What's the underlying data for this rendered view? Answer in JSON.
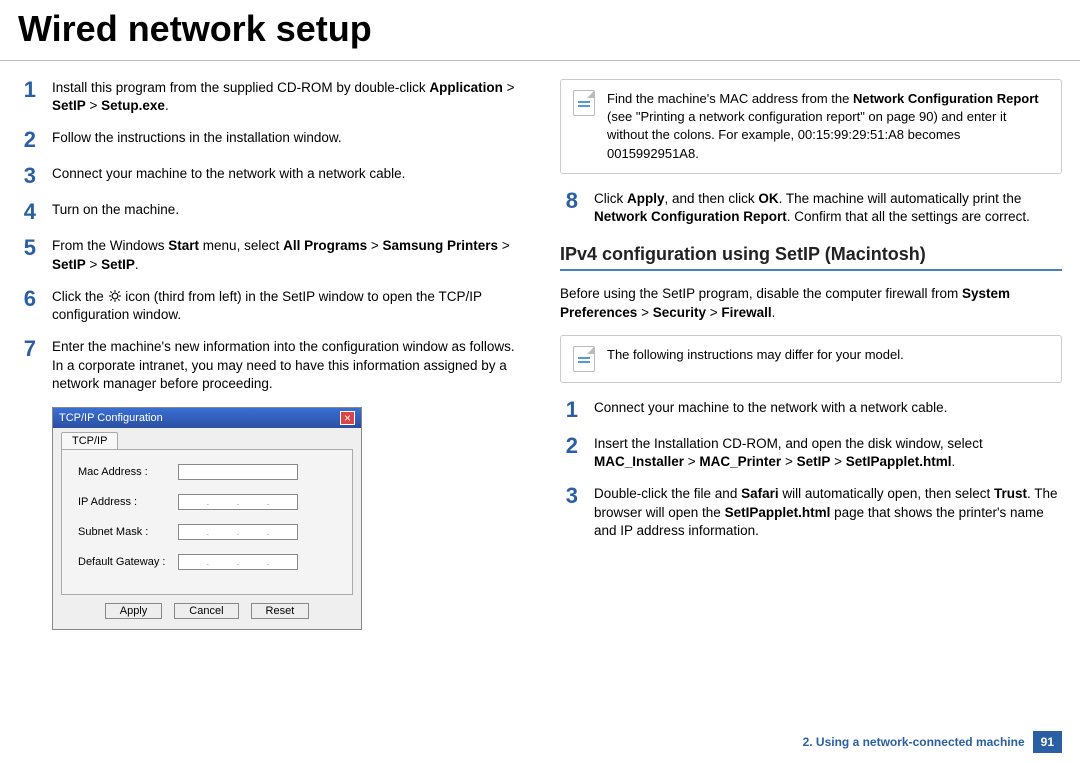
{
  "title": "Wired network setup",
  "left_steps": [
    {
      "num": "1",
      "html": "Install this program from the supplied CD-ROM by double-click <b>Application</b> > <b>SetIP</b> > <b>Setup.exe</b>."
    },
    {
      "num": "2",
      "html": "Follow the instructions in the installation window."
    },
    {
      "num": "3",
      "html": "Connect your machine to the network with a network cable."
    },
    {
      "num": "4",
      "html": "Turn on the machine."
    },
    {
      "num": "5",
      "html": "From the Windows <b>Start</b> menu, select <b>All Programs</b> > <b>Samsung Printers</b> > <b>SetIP</b> > <b>SetIP</b>."
    },
    {
      "num": "6",
      "html": "Click the <span class='gear-icon' data-name='gear-icon' data-interactable='false'><svg viewBox='0 0 24 24' width='14' height='14'><circle cx='12' cy='12' r='5' fill='none' stroke='#000' stroke-width='2'/><g stroke='#000' stroke-width='2'><line x1='12' y1='2' x2='12' y2='5'/><line x1='12' y1='19' x2='12' y2='22'/><line x1='2' y1='12' x2='5' y2='12'/><line x1='19' y1='12' x2='22' y2='12'/><line x1='4.2' y1='4.2' x2='6.3' y2='6.3'/><line x1='17.7' y1='17.7' x2='19.8' y2='19.8'/><line x1='4.2' y1='19.8' x2='6.3' y2='17.7'/><line x1='17.7' y1='6.3' x2='19.8' y2='4.2'/></g></svg></span> icon (third from left) in the SetIP window to open the TCP/IP configuration window."
    },
    {
      "num": "7",
      "html": "Enter the machine's new information into the configuration window as follows. In a corporate intranet, you may need to have this information assigned by a network manager before proceeding."
    }
  ],
  "configshot": {
    "title": "TCP/IP Configuration",
    "tab": "TCP/IP",
    "labels": [
      "Mac Address :",
      "IP Address :",
      "Subnet Mask :",
      "Default Gateway :"
    ],
    "buttons": [
      "Apply",
      "Cancel",
      "Reset"
    ]
  },
  "right_note1": "Find the machine's MAC address from the <b>Network Configuration Report</b> (see \"Printing a network configuration report\" on page 90) and enter it without the colons. For example, 00:15:99:29:51:A8 becomes 0015992951A8.",
  "right_step8": {
    "num": "8",
    "html": "Click <b>Apply</b>, and then click <b>OK</b>. The machine will automatically print the <b>Network Configuration Report</b>. Confirm that all the settings are correct."
  },
  "section_heading": "IPv4 configuration using SetIP (Macintosh)",
  "right_para": "Before using the SetIP program, disable the computer firewall from <b>System Preferences</b> > <b>Security</b> > <b>Firewall</b>.",
  "right_note2": "The following instructions may differ for your model.",
  "right_steps": [
    {
      "num": "1",
      "html": "Connect your machine to the network with a network cable."
    },
    {
      "num": "2",
      "html": "Insert the Installation CD-ROM, and open the disk window, select <b>MAC_Installer</b> > <b>MAC_Printer</b> > <b>SetIP</b> > <b>SetIPapplet.html</b>."
    },
    {
      "num": "3",
      "html": "Double-click the file and <b>Safari</b> will automatically open, then select <b>Trust</b>. The browser will open the <b>SetIPapplet.html</b> page that shows the printer's name and IP address information."
    }
  ],
  "footer_chapter": "2.  Using a network-connected machine",
  "page_number": "91"
}
